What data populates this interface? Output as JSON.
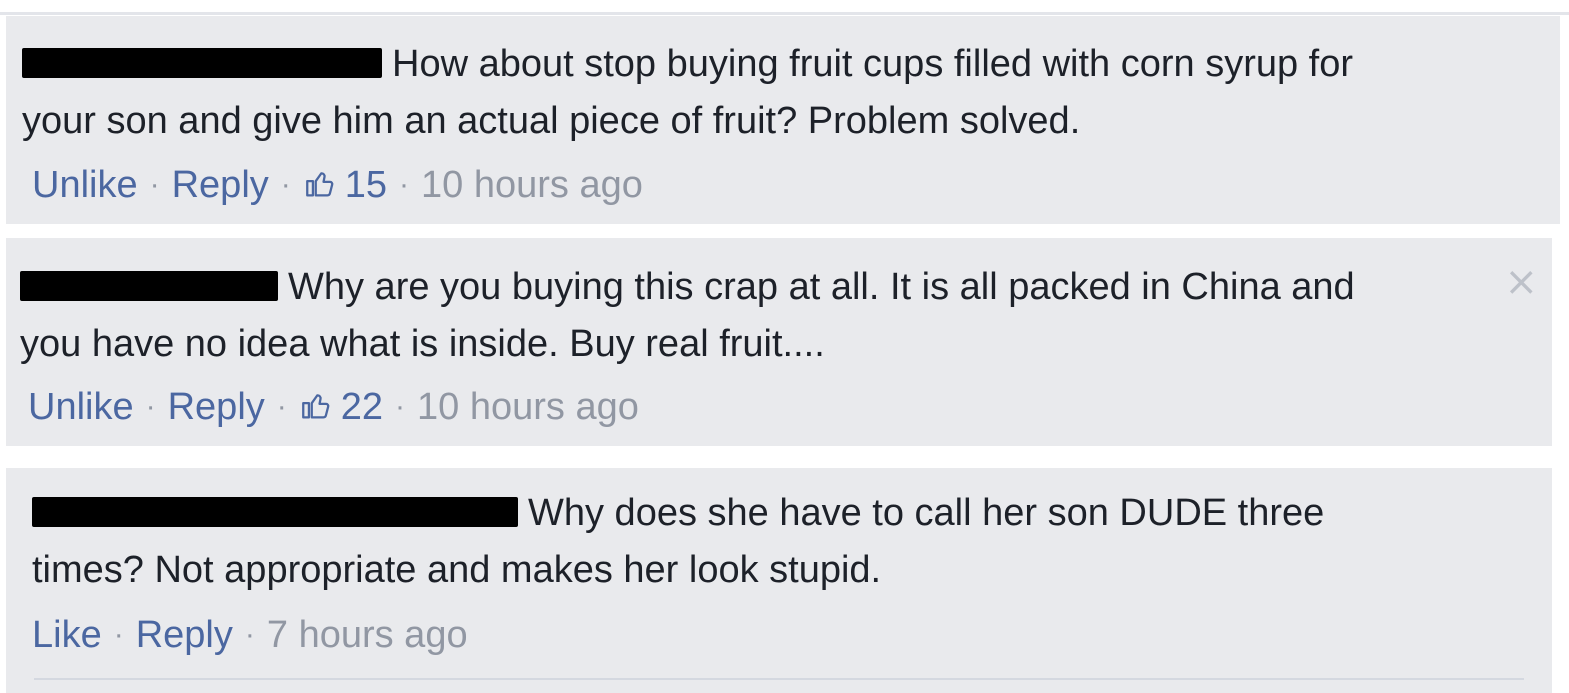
{
  "comments": [
    {
      "text_line1": "How about stop buying fruit cups filled with corn syrup for",
      "text_line2": "your son and give him an actual piece of fruit? Problem solved.",
      "like_action": "Unlike",
      "reply_label": "Reply",
      "likes_count": "15",
      "time_ago": "10 hours ago"
    },
    {
      "text_line1": "Why are you buying this crap at all. It is all packed in China and",
      "text_line2": "you have no idea what is inside. Buy real fruit....",
      "like_action": "Unlike",
      "reply_label": "Reply",
      "likes_count": "22",
      "time_ago": "10 hours ago",
      "close_icon": "×"
    },
    {
      "text_line1": "Why does she have to call her son DUDE three",
      "text_line2": "times? Not appropriate and makes her look stupid.",
      "like_action": "Like",
      "reply_label": "Reply",
      "time_ago": "7 hours ago"
    }
  ],
  "separator": "·",
  "icons": {
    "like": "thumbs-up-icon",
    "close": "close-icon"
  },
  "colors": {
    "comment_bg": "#e9eaed",
    "link": "#4b67a1",
    "meta_gray": "#9197a3",
    "text": "#1d2129"
  }
}
